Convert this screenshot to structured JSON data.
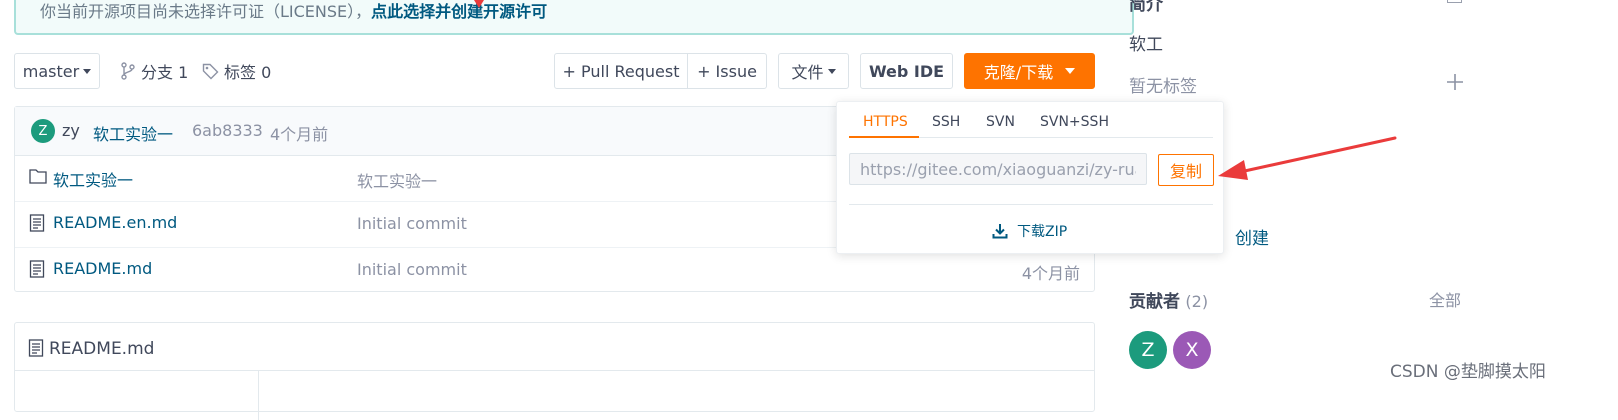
{
  "banner": {
    "text": "你当前开源项目尚未选择许可证（LICENSE），",
    "link": "点此选择并创建开源许可"
  },
  "toolbar": {
    "branch": "master",
    "branches_label": "分支 1",
    "tags_label": "标签 0",
    "pull_request": "+ Pull Request",
    "issue": "+ Issue",
    "file_menu": "文件",
    "web_ide": "Web IDE",
    "clone": "克隆/下载"
  },
  "commit": {
    "avatar_letter": "Z",
    "author": "zy",
    "message": "软工实验一",
    "hash": "6ab8333",
    "time": "4个月前"
  },
  "files": [
    {
      "name": "软工实验一",
      "type": "folder",
      "message": "软工实验一",
      "time": ""
    },
    {
      "name": "README.en.md",
      "type": "file",
      "message": "Initial commit",
      "time": ""
    },
    {
      "name": "README.md",
      "type": "file",
      "message": "Initial commit",
      "time": "4个月前"
    }
  ],
  "readme": {
    "title": "README.md"
  },
  "clone_dropdown": {
    "tabs": [
      "HTTPS",
      "SSH",
      "SVN",
      "SVN+SSH"
    ],
    "active_tab": "HTTPS",
    "url": "https://gitee.com/xiaoguanzi/zy-ruan-gong",
    "copy": "复制",
    "download_zip": "下载ZIP"
  },
  "sidebar": {
    "intro_title": "简介",
    "description": "软工",
    "no_tags": "暂无标签",
    "create": "创建",
    "contributors_title": "贡献者",
    "contributors_count": "(2)",
    "contributors_all": "全部",
    "contributors": [
      {
        "letter": "Z",
        "color": "#1c9b7d"
      },
      {
        "letter": "X",
        "color": "#9b59b6"
      }
    ]
  },
  "watermark": "CSDN @垫脚摸太阳",
  "colors": {
    "accent": "#fe7300",
    "link": "#005980",
    "annotation_arrow": "#ea3b3b"
  }
}
